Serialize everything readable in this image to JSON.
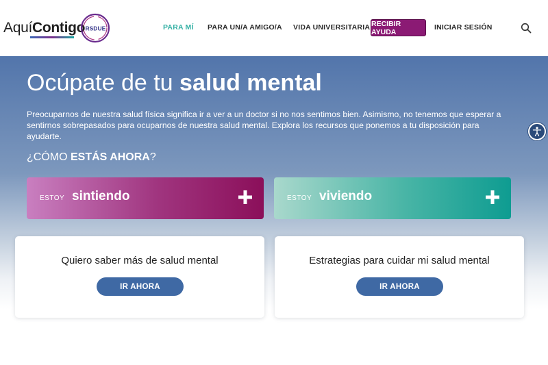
{
  "header": {
    "logo": {
      "part1": "Aquí",
      "part2": "Contigo",
      "badge": "RSDUE"
    },
    "nav": [
      {
        "label": "PARA MÍ",
        "active": true
      },
      {
        "label": "PARA UN/A AMIGO/A",
        "active": false
      },
      {
        "label": "VIDA UNIVERSITARIA",
        "active": false
      },
      {
        "label": "RECIBIR AYUDA",
        "active": false
      },
      {
        "label": "INICIAR SESIÓN",
        "active": false
      }
    ],
    "search_icon": "search-icon"
  },
  "hero": {
    "title_regular": "Ocúpate de tu ",
    "title_bold": "salud mental",
    "description": "Preocuparnos de nuestra salud física significa ir a ver a un doctor si no nos sentimos bien. Asimismo, no tenemos que esperar a sentirnos sobrepasados para ocuparnos de nuestra salud mental. Explora los recursos que ponemos a tu disposición para ayudarte.",
    "question_pre": "¿CÓMO ",
    "question_bold": "ESTÁS AHORA",
    "question_post": "?"
  },
  "feel_cards": [
    {
      "prefix": "ESTOY",
      "word": "sintiendo"
    },
    {
      "prefix": "ESTOY",
      "word": "viviendo"
    }
  ],
  "info_cards": [
    {
      "title": "Quiero saber más de salud mental",
      "button": "IR AHORA"
    },
    {
      "title": "Estrategias para cuidar mi salud mental",
      "button": "IR AHORA"
    }
  ],
  "colors": {
    "accent_teal": "#35b1a5",
    "help_button": "#8b1a74",
    "card_button": "#3f69a4"
  }
}
